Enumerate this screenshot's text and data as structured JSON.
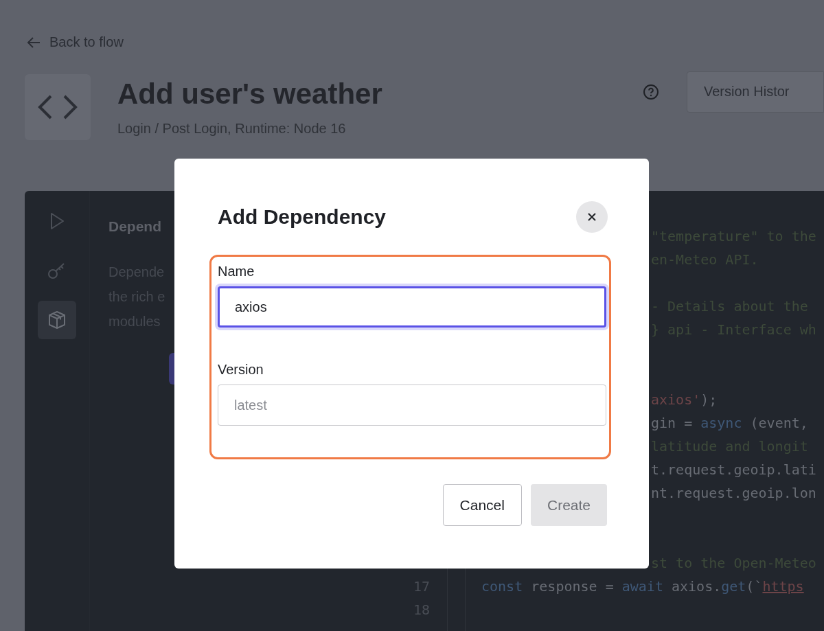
{
  "back_link": {
    "label": "Back to flow"
  },
  "header": {
    "title": "Add user's weather",
    "subtitle": "Login / Post Login, Runtime: Node 16",
    "version_button": "Version Histor"
  },
  "rail": [
    {
      "kind": "play",
      "selected": false
    },
    {
      "kind": "key",
      "selected": false
    },
    {
      "kind": "box",
      "selected": true
    }
  ],
  "side_pane": {
    "title": "Depend",
    "lines": [
      "Depende",
      "the rich e",
      "modules"
    ]
  },
  "code_lines": [
    {
      "kind": "blank"
    },
    {
      "kind": "clipped",
      "segments": [
        {
          "text": "\"temperature\" to the",
          "kind": "comment"
        }
      ]
    },
    {
      "kind": "clipped",
      "segments": [
        {
          "text": "en-Meteo API.",
          "kind": "comment"
        }
      ]
    },
    {
      "kind": "blank"
    },
    {
      "kind": "clipped",
      "segments": [
        {
          "text": "- Details about the",
          "kind": "comment"
        }
      ]
    },
    {
      "kind": "clipped",
      "segments": [
        {
          "text": "} api - Interface wh",
          "kind": "comment"
        }
      ]
    },
    {
      "kind": "blank"
    },
    {
      "kind": "blank"
    },
    {
      "kind": "clipped",
      "segments": [
        {
          "text": "axios'",
          "kind": "string"
        },
        {
          "text": ");",
          "kind": "plain"
        }
      ]
    },
    {
      "kind": "clipped",
      "segments": [
        {
          "text": "gin = ",
          "kind": "plain"
        },
        {
          "text": "async",
          "kind": "keyword"
        },
        {
          "text": " (event,",
          "kind": "plain"
        }
      ]
    },
    {
      "kind": "clipped",
      "segments": [
        {
          "text": "latitude and longit",
          "kind": "comment"
        }
      ]
    },
    {
      "kind": "clipped",
      "segments": [
        {
          "text": "t.request.geoip.lati",
          "kind": "plain"
        }
      ]
    },
    {
      "kind": "clipped",
      "segments": [
        {
          "text": "nt.request.geoip.lon",
          "kind": "plain"
        }
      ]
    },
    {
      "kind": "blank"
    },
    {
      "kind": "blank"
    },
    {
      "kind": "clipped",
      "segments": [
        {
          "text": "st to the Open-Meteo",
          "kind": "comment"
        }
      ]
    },
    {
      "kind": "full",
      "number": "17",
      "segments": [
        {
          "text": "const",
          "kind": "keyword"
        },
        {
          "text": " response = ",
          "kind": "plain"
        },
        {
          "text": "await",
          "kind": "keyword"
        },
        {
          "text": " axios.",
          "kind": "plain"
        },
        {
          "text": "get",
          "kind": "keyword"
        },
        {
          "text": "(`",
          "kind": "plain"
        },
        {
          "text": "https",
          "kind": "link"
        }
      ]
    },
    {
      "kind": "full",
      "number": "18"
    }
  ],
  "dialog": {
    "title": "Add Dependency",
    "fields": [
      {
        "label": "Name",
        "value": "axios",
        "focused": true
      },
      {
        "label": "Version",
        "placeholder": "latest",
        "focused": false
      }
    ],
    "buttons": [
      {
        "label": "Cancel",
        "kind": "secondary",
        "disabled": false
      },
      {
        "label": "Create",
        "kind": "primary",
        "disabled": true
      }
    ]
  }
}
